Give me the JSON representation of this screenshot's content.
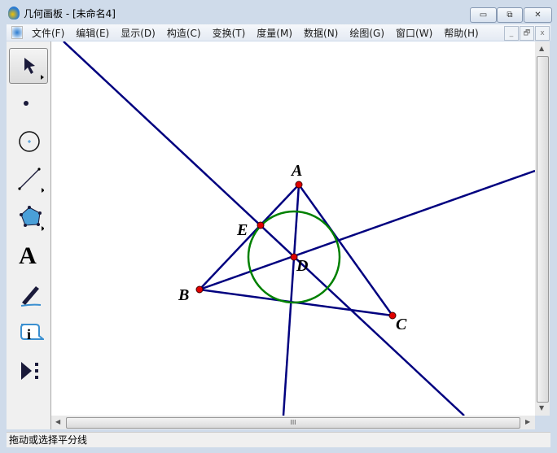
{
  "window": {
    "title": "几何画板 - [未命名4]",
    "minimize": "▭",
    "restore": "⧉",
    "close": "✕"
  },
  "menu": [
    "文件(F)",
    "编辑(E)",
    "显示(D)",
    "构造(C)",
    "变换(T)",
    "度量(M)",
    "数据(N)",
    "绘图(G)",
    "窗口(W)",
    "帮助(H)"
  ],
  "mdi": {
    "minimize": "_",
    "restore": "🗗",
    "close": "x"
  },
  "tools": {
    "text_tool": "A"
  },
  "points": {
    "A": "A",
    "B": "B",
    "C": "C",
    "D": "D",
    "E": "E"
  },
  "colors": {
    "line": "#00007f",
    "circle": "#008000",
    "point": "#e00000"
  },
  "status": "拖动或选择平分线",
  "scroll_grip": "III"
}
